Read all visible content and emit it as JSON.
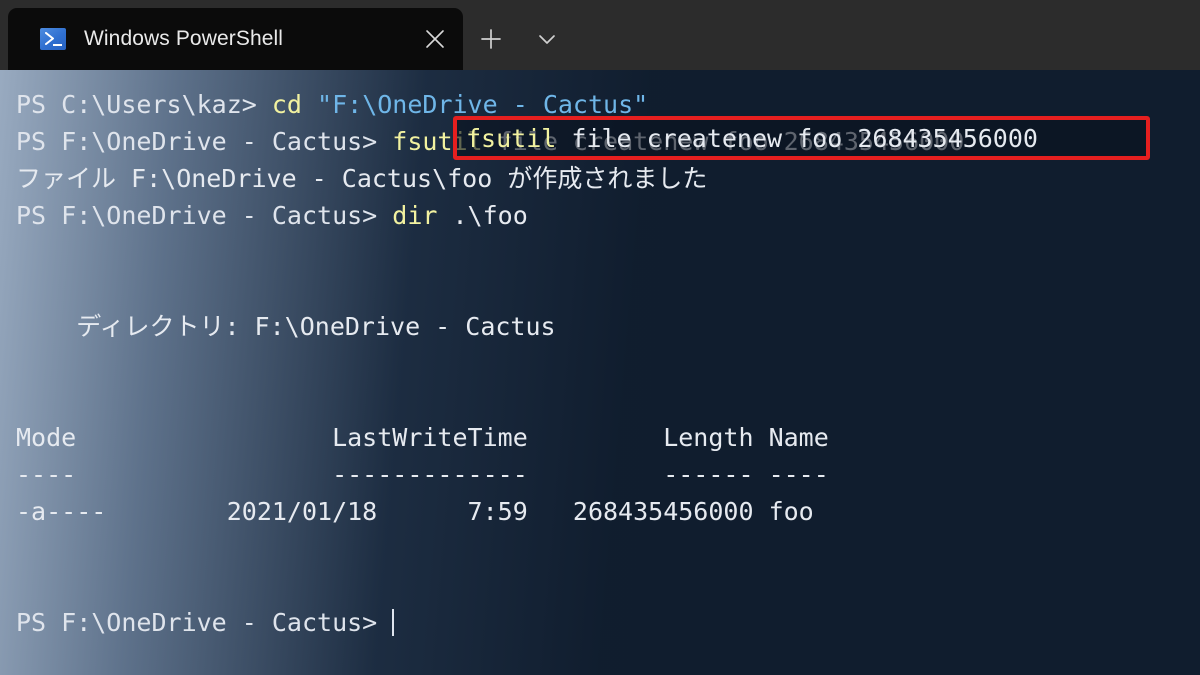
{
  "window": {
    "titlebar": {
      "tab": {
        "icon": "powershell-icon",
        "title": "Windows PowerShell",
        "close_label": "×"
      },
      "new_tab_label": "+",
      "dropdown_label": "⌄"
    }
  },
  "terminal": {
    "font_size_px": 25,
    "colors": {
      "prompt": "#dfe4ec",
      "command": "#f2f2a0",
      "string": "#6fb6e8",
      "output": "#e6eaf0",
      "highlight_border": "#e61f1f",
      "background_dark": "#101d2e",
      "background_light": "#a0b2c8"
    },
    "lines": [
      {
        "id": "line-1-cd",
        "segments": [
          {
            "text": "PS C:\\Users\\kaz> ",
            "color": "prompt"
          },
          {
            "text": "cd",
            "color": "command"
          },
          {
            "text": " ",
            "color": "output"
          },
          {
            "text": "\"F:\\OneDrive - Cactus\"",
            "color": "string"
          }
        ]
      },
      {
        "id": "line-2-fsutil",
        "segments": [
          {
            "text": "PS F:\\OneDrive - Cactus> ",
            "color": "prompt"
          },
          {
            "text": "fsutil",
            "color": "command"
          },
          {
            "text": " file createnew foo 268435456000",
            "color": "output"
          }
        ]
      },
      {
        "id": "line-3-created-message",
        "segments": [
          {
            "text": "ファイル F:\\OneDrive - Cactus\\foo が作成されました",
            "color": "output"
          }
        ]
      },
      {
        "id": "line-4-dir",
        "segments": [
          {
            "text": "PS F:\\OneDrive - Cactus> ",
            "color": "prompt"
          },
          {
            "text": "dir",
            "color": "command"
          },
          {
            "text": " .\\foo",
            "color": "output"
          }
        ]
      },
      {
        "id": "line-5-blank",
        "segments": [
          {
            "text": " ",
            "color": "output"
          }
        ]
      },
      {
        "id": "line-6-blank",
        "segments": [
          {
            "text": " ",
            "color": "output"
          }
        ]
      },
      {
        "id": "line-7-directory-header",
        "segments": [
          {
            "text": "    ディレクトリ: F:\\OneDrive - Cactus",
            "color": "output"
          }
        ]
      },
      {
        "id": "line-8-blank",
        "segments": [
          {
            "text": " ",
            "color": "output"
          }
        ]
      },
      {
        "id": "line-9-blank",
        "segments": [
          {
            "text": " ",
            "color": "output"
          }
        ]
      },
      {
        "id": "line-10-table-header",
        "segments": [
          {
            "text": "Mode                 LastWriteTime         Length Name",
            "color": "output"
          }
        ]
      },
      {
        "id": "line-11-table-rule",
        "segments": [
          {
            "text": "----                 -------------         ------ ----",
            "color": "output"
          }
        ]
      },
      {
        "id": "line-12-table-row",
        "segments": [
          {
            "text": "-a----        2021/01/18      7:59   268435456000 foo",
            "color": "output"
          }
        ]
      },
      {
        "id": "line-13-blank",
        "segments": [
          {
            "text": " ",
            "color": "output"
          }
        ]
      },
      {
        "id": "line-14-blank",
        "segments": [
          {
            "text": " ",
            "color": "output"
          }
        ]
      },
      {
        "id": "line-15-final-prompt",
        "segments": [
          {
            "text": "PS F:\\OneDrive - Cactus> ",
            "color": "prompt"
          }
        ],
        "cursor": true
      }
    ],
    "highlight": {
      "id": "fsutil-command-highlight",
      "segments": [
        {
          "text": "fsutil",
          "color": "command"
        },
        {
          "text": " file createnew foo 268435456000",
          "color": "output"
        }
      ]
    },
    "table": {
      "headers": [
        "Mode",
        "LastWriteTime",
        "Length",
        "Name"
      ],
      "rows": [
        {
          "mode": "-a----",
          "date": "2021/01/18",
          "time": "7:59",
          "length": "268435456000",
          "name": "foo"
        }
      ]
    }
  }
}
